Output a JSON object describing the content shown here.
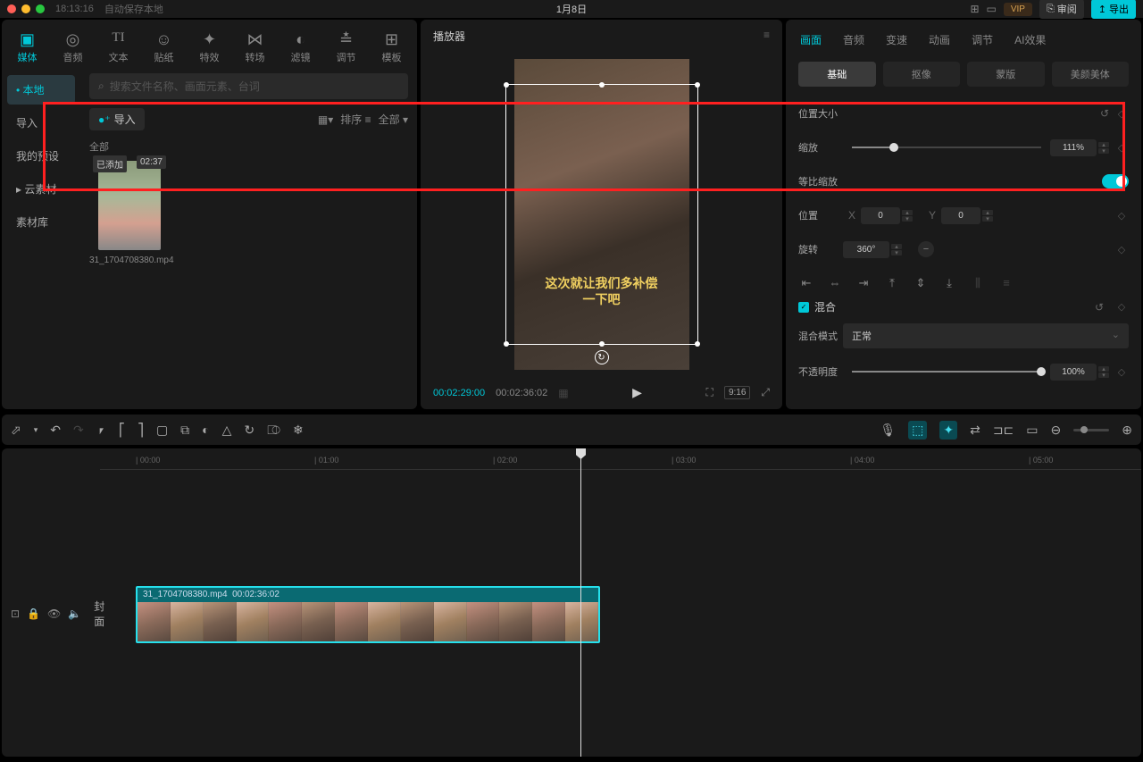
{
  "titlebar": {
    "time": "18:13:16",
    "autosave": "自动保存本地",
    "title": "1月8日",
    "vip": "VIP",
    "review": "审阅",
    "export": "导出"
  },
  "tooltabs": [
    {
      "icon": "▢",
      "label": "媒体"
    },
    {
      "icon": "♪",
      "label": "音频"
    },
    {
      "icon": "TI",
      "label": "文本"
    },
    {
      "icon": "☺",
      "label": "贴纸"
    },
    {
      "icon": "✦",
      "label": "特效"
    },
    {
      "icon": "⋈",
      "label": "转场"
    },
    {
      "icon": "◎",
      "label": "滤镜"
    },
    {
      "icon": "≡",
      "label": "调节"
    },
    {
      "icon": "⊞",
      "label": "模板"
    }
  ],
  "sidebar": {
    "items": [
      "本地",
      "导入",
      "我的预设",
      "云素材",
      "素材库"
    ]
  },
  "media": {
    "search_placeholder": "搜索文件名称、画面元素、台词",
    "import": "导入",
    "sort": "排序",
    "all": "全部",
    "section": "全部",
    "clip_badge": "已添加",
    "clip_duration": "02:37",
    "clip_name": "31_1704708380.mp4"
  },
  "player": {
    "title": "播放器",
    "subtitle_line1": "这次就让我们多补偿",
    "subtitle_line2": "一下吧",
    "tc_current": "00:02:29:00",
    "tc_total": "00:02:36:02",
    "ratio": "9:16"
  },
  "props": {
    "tabs": [
      "画面",
      "音频",
      "变速",
      "动画",
      "调节",
      "AI效果"
    ],
    "subtabs": [
      "基础",
      "抠像",
      "蒙版",
      "美颜美体"
    ],
    "position_size": "位置大小",
    "scale": "缩放",
    "scale_value": "111%",
    "uniform_scale": "等比缩放",
    "position": "位置",
    "pos_x": "0",
    "pos_y": "0",
    "rotation": "旋转",
    "rotation_value": "360°",
    "blend": "混合",
    "blend_mode": "混合模式",
    "blend_mode_value": "正常",
    "opacity": "不透明度",
    "opacity_value": "100%"
  },
  "timeline": {
    "clip_name": "31_1704708380.mp4",
    "clip_dur": "00:02:36:02",
    "cover": "封面",
    "ticks": [
      "00:00",
      "01:00",
      "02:00",
      "03:00",
      "04:00",
      "05:00"
    ]
  }
}
